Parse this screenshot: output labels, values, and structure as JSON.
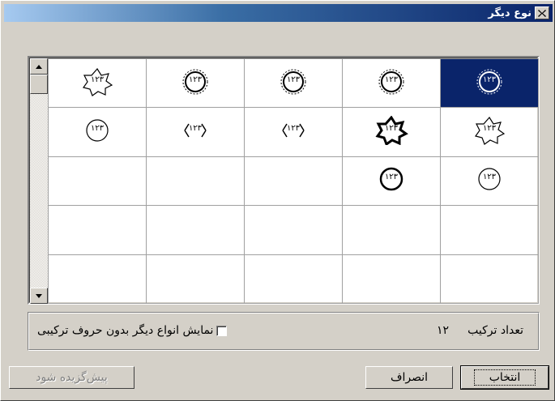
{
  "window": {
    "title": "نوع دیگر"
  },
  "grid": {
    "selected_index": 0,
    "cells": [
      {
        "glyph": "۱۲۳",
        "style": "ornate-circle-selected"
      },
      {
        "glyph": "۱۲۳",
        "style": "ornate-flower"
      },
      {
        "glyph": "۱۲۳",
        "style": "ornate-wreath"
      },
      {
        "glyph": "۱۲۳",
        "style": "ornate-ring"
      },
      {
        "glyph": "۱۲۳",
        "style": "star-outline"
      },
      {
        "glyph": "۱۲۳",
        "style": "star-eight"
      },
      {
        "glyph": "۱۲۳",
        "style": "star-bold"
      },
      {
        "glyph": "۱۲۳",
        "style": "bracket-ornate"
      },
      {
        "glyph": "۱۲۳",
        "style": "bracket-dotted"
      },
      {
        "glyph": "۱۲۳",
        "style": "circle-thin"
      },
      {
        "glyph": "۱۲۳",
        "style": "circle-plain"
      },
      {
        "glyph": "۱۲۳",
        "style": "circle-bold"
      },
      {
        "glyph": "",
        "style": "empty"
      },
      {
        "glyph": "",
        "style": "empty"
      },
      {
        "glyph": "",
        "style": "empty"
      },
      {
        "glyph": "",
        "style": "empty"
      },
      {
        "glyph": "",
        "style": "empty"
      },
      {
        "glyph": "",
        "style": "empty"
      },
      {
        "glyph": "",
        "style": "empty"
      },
      {
        "glyph": "",
        "style": "empty"
      },
      {
        "glyph": "",
        "style": "empty"
      },
      {
        "glyph": "",
        "style": "empty"
      },
      {
        "glyph": "",
        "style": "empty"
      },
      {
        "glyph": "",
        "style": "empty"
      },
      {
        "glyph": "",
        "style": "empty"
      }
    ]
  },
  "options": {
    "count_label": "تعداد ترکیب",
    "count_value": "۱۲",
    "show_other_label": "نمایش انواع دیگر بدون حروف ترکیبی",
    "show_other_checked": false
  },
  "buttons": {
    "ok_label": "انتخاب",
    "cancel_label": "انصراف",
    "default_label": "پیش‌گزیده شود"
  },
  "colors": {
    "selection": "#0a246a",
    "title_gradient_start": "#0a246a",
    "face": "#d4d0c8"
  }
}
